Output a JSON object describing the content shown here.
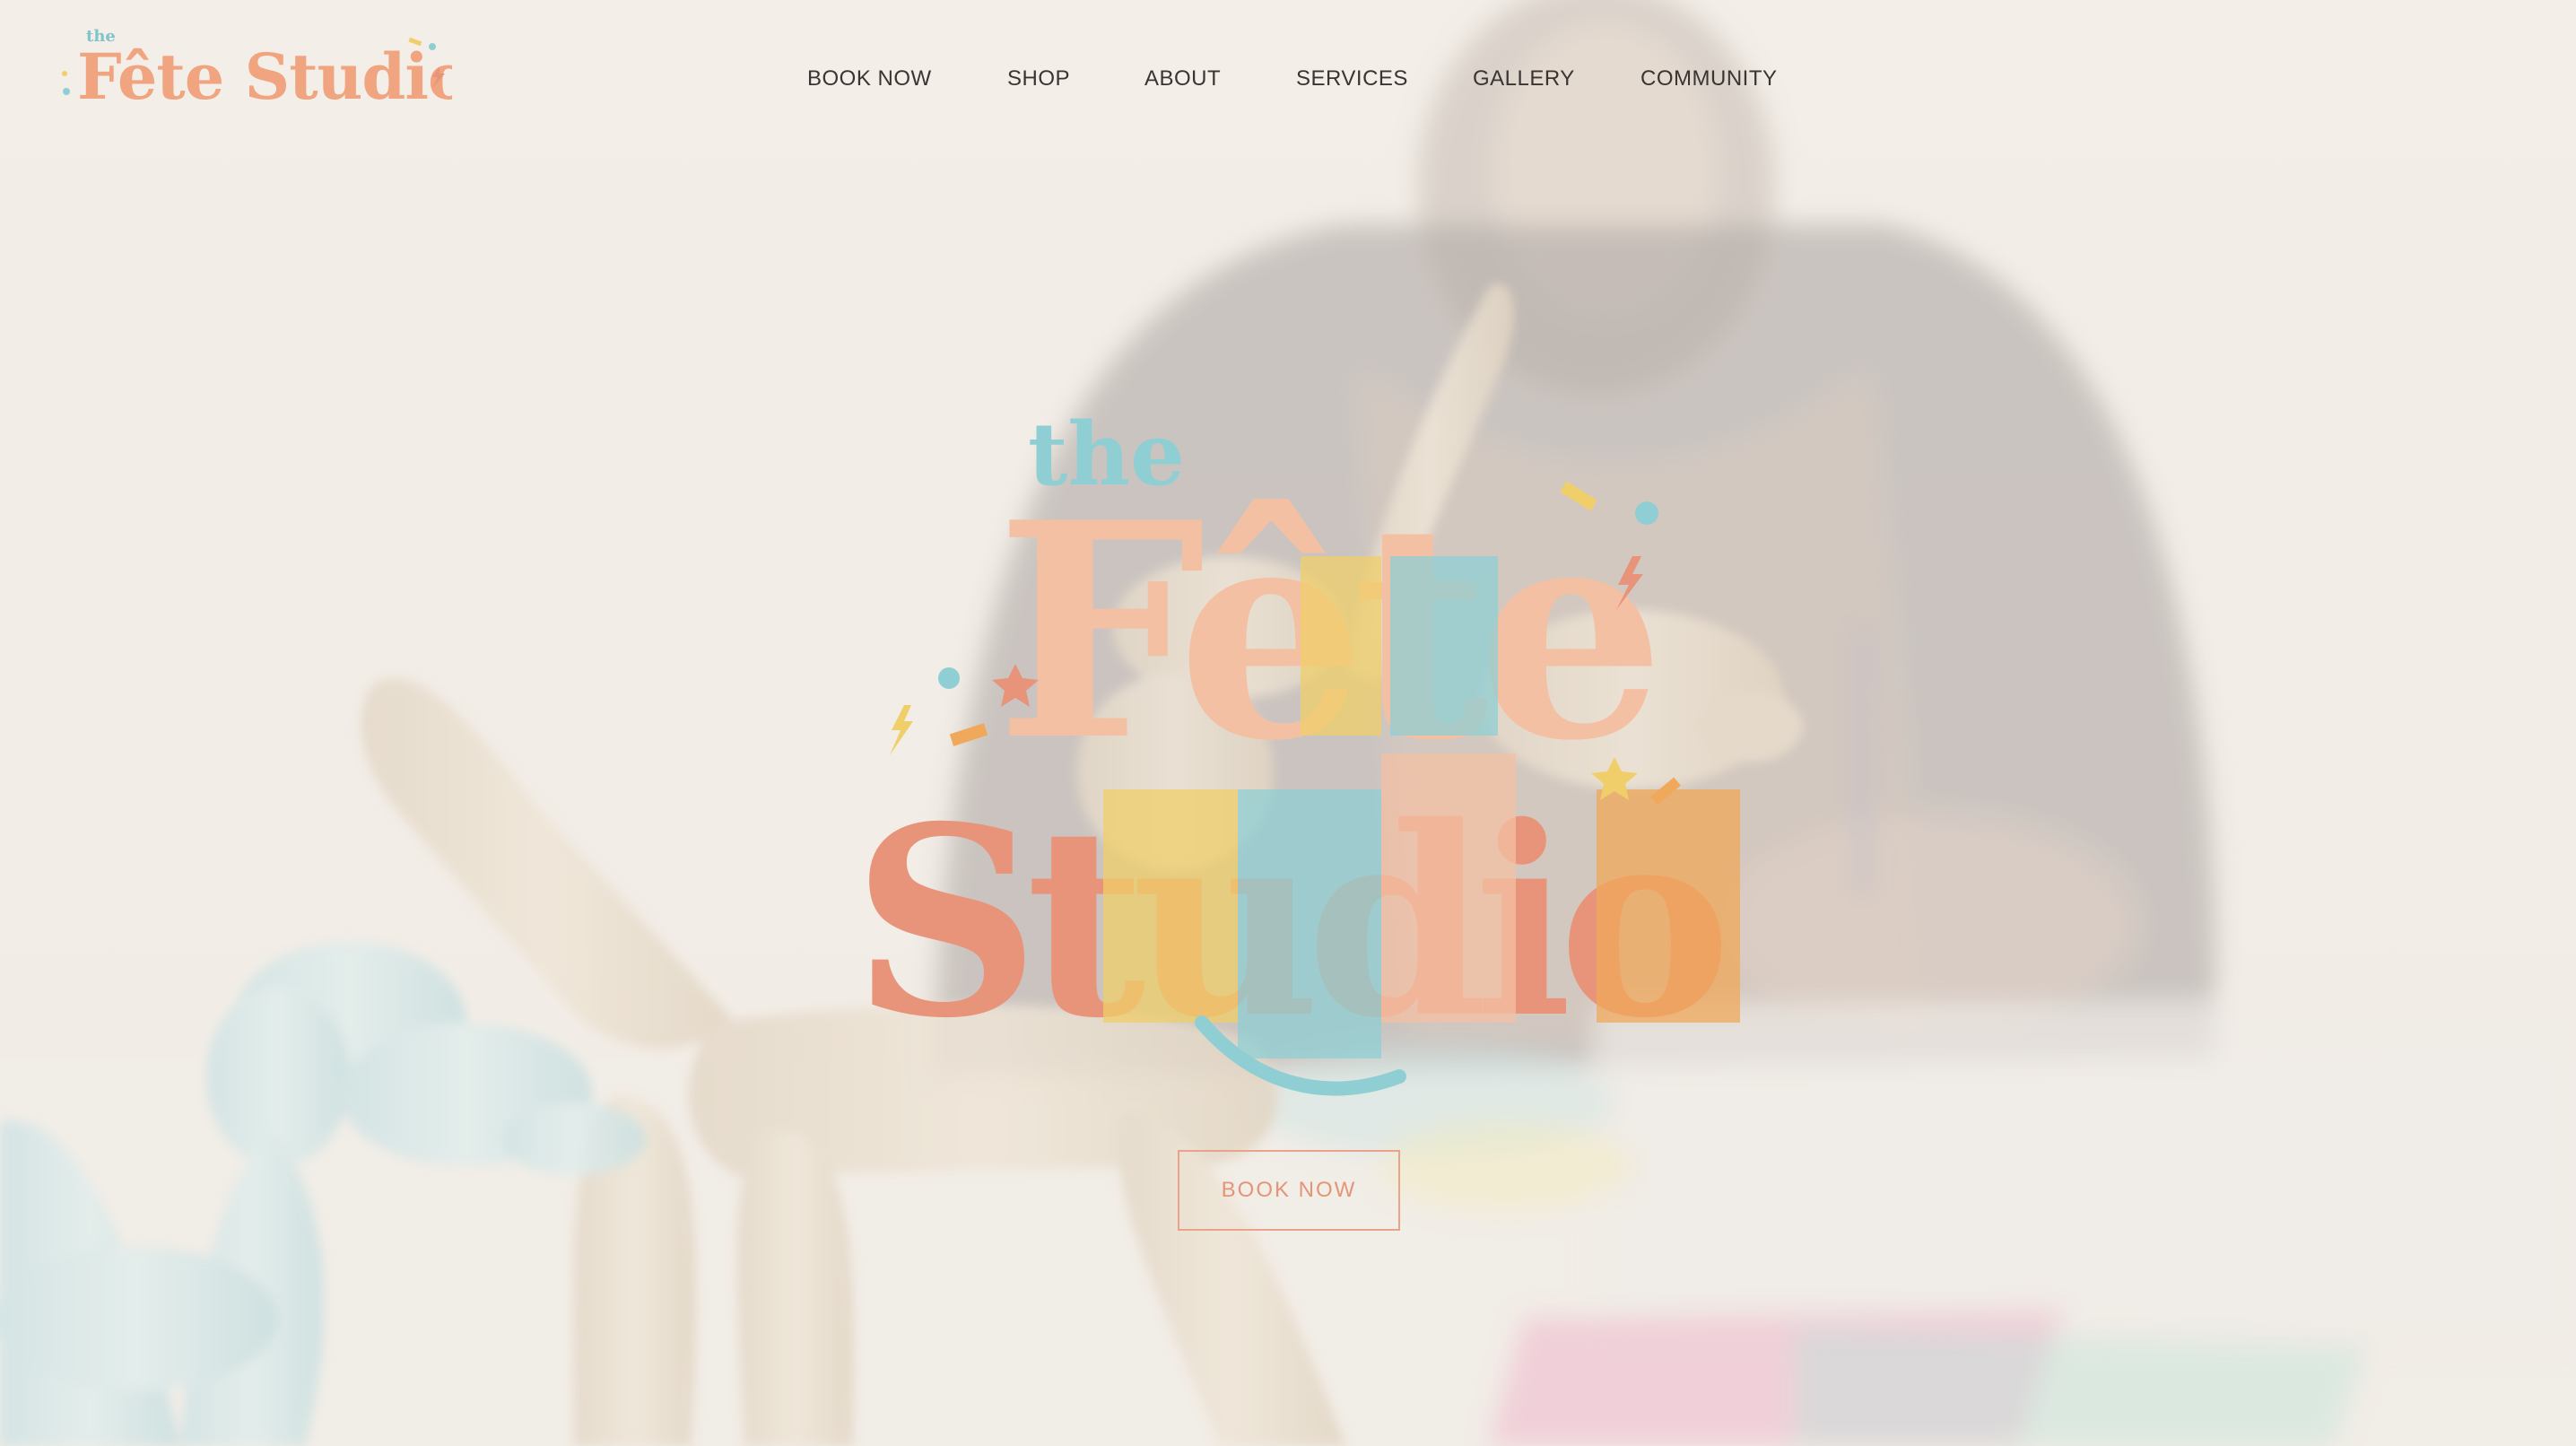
{
  "brand": {
    "small_logo": {
      "the": "the",
      "name": "Fête Studio"
    },
    "hero_logo": {
      "the": "the",
      "word1": "Fête",
      "word2": "Studio"
    }
  },
  "nav": {
    "items": [
      {
        "label": "BOOK NOW"
      },
      {
        "label": "SHOP"
      },
      {
        "label": "ABOUT"
      },
      {
        "label": "SERVICES"
      },
      {
        "label": "GALLERY"
      },
      {
        "label": "COMMUNITY"
      }
    ]
  },
  "hero": {
    "cta_label": "BOOK NOW"
  },
  "colors": {
    "coral": "#e8947a",
    "peach": "#f4c4a8",
    "yellow": "#f0cf6a",
    "teal": "#8fcfd4",
    "orange": "#f0a85a",
    "nav_text": "#3a3532",
    "background_wash": "#f3eee8"
  },
  "icons": {
    "confetti": [
      "dot-icon",
      "star-icon",
      "lightning-icon",
      "confetti-strip-icon"
    ]
  }
}
